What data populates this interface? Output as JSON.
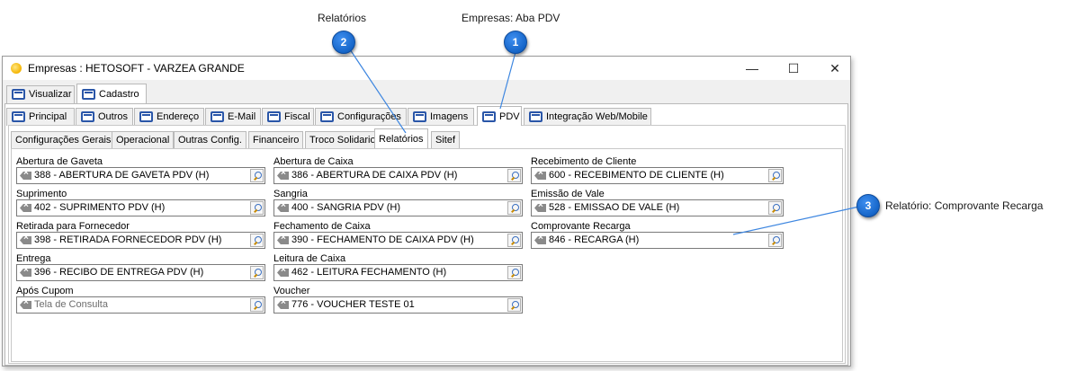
{
  "callouts": [
    {
      "number": "1",
      "label": "Empresas: Aba PDV"
    },
    {
      "number": "2",
      "label": "Relatórios"
    },
    {
      "number": "3",
      "label": "Relatório: Comprovante Recarga"
    }
  ],
  "window": {
    "title": "Empresas  : HETOSOFT - VARZEA GRANDE",
    "controls": {
      "minimize": "—",
      "maximize": "☐",
      "close": "✕"
    }
  },
  "top_tabs": [
    {
      "label": "Visualizar",
      "active": false
    },
    {
      "label": "Cadastro",
      "active": true
    }
  ],
  "main_tabs": [
    {
      "label": "Principal"
    },
    {
      "label": "Outros"
    },
    {
      "label": "Endereço"
    },
    {
      "label": "E-Mail"
    },
    {
      "label": "Fiscal"
    },
    {
      "label": "Configurações"
    },
    {
      "label": "Imagens"
    },
    {
      "label": "PDV",
      "active": true
    },
    {
      "label": "Integração Web/Mobile"
    }
  ],
  "sub_tabs": [
    {
      "label": "Configurações Gerais"
    },
    {
      "label": "Operacional"
    },
    {
      "label": "Outras Config."
    },
    {
      "label": "Financeiro"
    },
    {
      "label": "Troco Solidario"
    },
    {
      "label": "Relatórios",
      "active": true
    },
    {
      "label": "Sitef"
    }
  ],
  "fields": {
    "col1": [
      {
        "label": "Abertura de Gaveta",
        "value": "388 - ABERTURA DE GAVETA PDV (H)"
      },
      {
        "label": "Suprimento",
        "value": "402 - SUPRIMENTO PDV (H)"
      },
      {
        "label": "Retirada para Fornecedor",
        "value": "398 - RETIRADA FORNECEDOR PDV (H)"
      },
      {
        "label": "Entrega",
        "value": "396 - RECIBO DE ENTREGA PDV (H)"
      },
      {
        "label": "Após Cupom",
        "value": "",
        "placeholder": "Tela de Consulta"
      }
    ],
    "col2": [
      {
        "label": "Abertura de Caixa",
        "value": "386 - ABERTURA DE CAIXA PDV (H)"
      },
      {
        "label": "Sangria",
        "value": "400 - SANGRIA PDV (H)"
      },
      {
        "label": "Fechamento de Caixa",
        "value": "390 - FECHAMENTO DE CAIXA PDV (H)"
      },
      {
        "label": "Leitura de Caixa",
        "value": "462 - LEITURA FECHAMENTO (H)"
      },
      {
        "label": "Voucher",
        "value": "776 - VOUCHER TESTE 01"
      }
    ],
    "col3": [
      {
        "label": "Recebimento de Cliente",
        "value": "600 - RECEBIMENTO DE CLIENTE (H)"
      },
      {
        "label": "Emissão de Vale",
        "value": "528 - EMISSAO DE VALE (H)"
      },
      {
        "label": "Comprovante Recarga",
        "value": "846 - RECARGA (H)"
      }
    ]
  },
  "icons": {
    "app": "app-sun-icon",
    "tab": "window-tab-icon",
    "clear": "clear-field-icon",
    "search": "magnifier-search-icon"
  },
  "colors": {
    "callout_bubble": "#1565c8",
    "callout_line": "#3d86e0",
    "tab_icon": "#2a56a8"
  }
}
